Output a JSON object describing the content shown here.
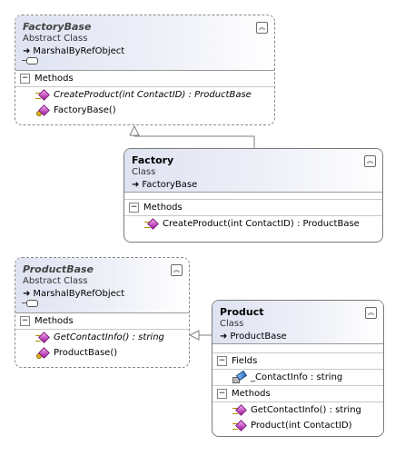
{
  "classes": {
    "factory_base": {
      "name": "FactoryBase",
      "kind": "Abstract Class",
      "base": "MarshalByRefObject",
      "section": "Methods",
      "methods": [
        "CreateProduct(int ContactID) : ProductBase",
        "FactoryBase()"
      ]
    },
    "factory": {
      "name": "Factory",
      "kind": "Class",
      "base": "FactoryBase",
      "section": "Methods",
      "methods": [
        "CreateProduct(int ContactID) : ProductBase"
      ]
    },
    "product_base": {
      "name": "ProductBase",
      "kind": "Abstract Class",
      "base": "MarshalByRefObject",
      "section": "Methods",
      "methods": [
        "GetContactInfo() : string",
        "ProductBase()"
      ]
    },
    "product": {
      "name": "Product",
      "kind": "Class",
      "base": "ProductBase",
      "fields_section": "Fields",
      "fields": [
        "_ContactInfo : string"
      ],
      "section": "Methods",
      "methods": [
        "GetContactInfo() : string",
        "Product(int ContactID)"
      ]
    }
  },
  "icons": {
    "collapse": "chevron-up-icon",
    "section_toggle": "minus-icon",
    "base_arrow": "arrow-right-icon",
    "interface": "lollipop-icon",
    "method": "method-icon",
    "field": "field-icon",
    "inheritance": "inheritance-arrow-icon"
  },
  "colors": {
    "header_gradient_start": "#dfe3f1",
    "border": "#7b7b7b",
    "method_icon": "#a0179c"
  }
}
